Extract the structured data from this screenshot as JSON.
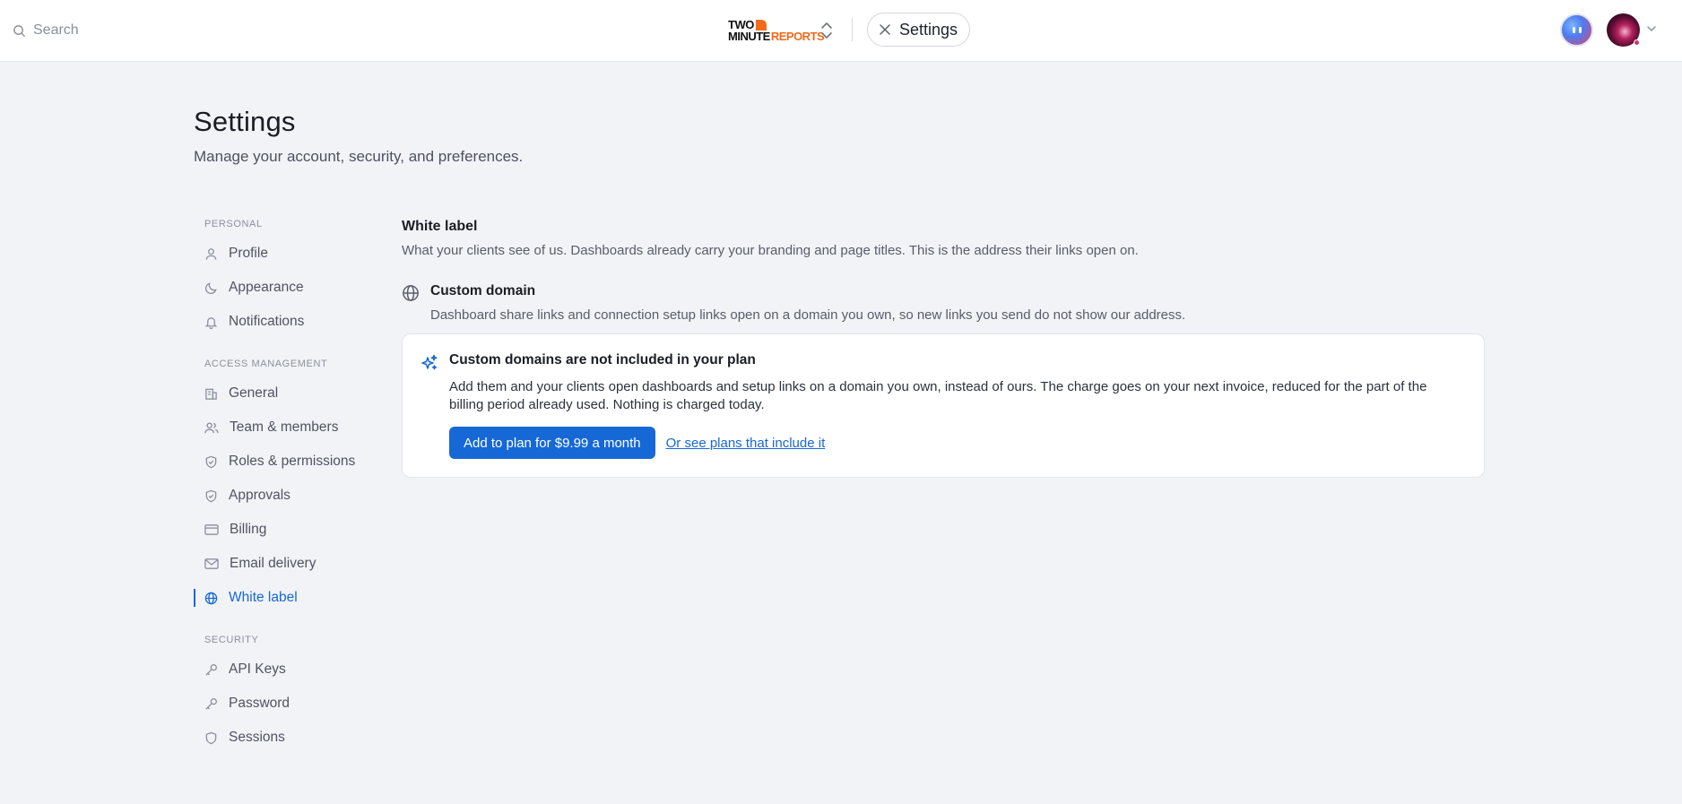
{
  "topbar": {
    "search_placeholder": "Search",
    "logo": {
      "line1": "TWO",
      "line2a": "MINUTE",
      "line2b": "REPORTS"
    },
    "breadcrumb": "Settings"
  },
  "page": {
    "title": "Settings",
    "subtitle": "Manage your account, security, and preferences."
  },
  "sidebar": {
    "sections": [
      {
        "label": "PERSONAL",
        "items": [
          {
            "label": "Profile",
            "icon": "user-icon"
          },
          {
            "label": "Appearance",
            "icon": "moon-icon"
          },
          {
            "label": "Notifications",
            "icon": "bell-icon"
          }
        ]
      },
      {
        "label": "ACCESS MANAGEMENT",
        "items": [
          {
            "label": "General",
            "icon": "building-icon"
          },
          {
            "label": "Team & members",
            "icon": "users-icon"
          },
          {
            "label": "Roles & permissions",
            "icon": "shield-check-icon"
          },
          {
            "label": "Approvals",
            "icon": "shield-check-icon"
          },
          {
            "label": "Billing",
            "icon": "credit-card-icon"
          },
          {
            "label": "Email delivery",
            "icon": "mail-icon"
          },
          {
            "label": "White label",
            "icon": "globe-icon",
            "active": true
          }
        ]
      },
      {
        "label": "SECURITY",
        "items": [
          {
            "label": "API Keys",
            "icon": "key-icon"
          },
          {
            "label": "Password",
            "icon": "key-icon"
          },
          {
            "label": "Sessions",
            "icon": "shield-icon"
          }
        ]
      }
    ]
  },
  "main": {
    "section_title": "White label",
    "section_desc": "What your clients see of us. Dashboards already carry your branding and page titles. This is the address their links open on.",
    "field_title": "Custom domain",
    "field_desc": "Dashboard share links and connection setup links open on a domain you own, so new links you send do not show our address.",
    "card": {
      "title": "Custom domains are not included in your plan",
      "body": "Add them and your clients open dashboards and setup links on a domain you own, instead of ours. The charge goes on your next invoice, reduced for the part of the billing period already used. Nothing is charged today.",
      "primary_label": "Add to plan for $9.99 a month",
      "link_label": "Or see plans that include it"
    }
  },
  "colors": {
    "accent": "#1668d6",
    "brand_orange": "#f26a1b",
    "background": "#f2f3f7"
  }
}
